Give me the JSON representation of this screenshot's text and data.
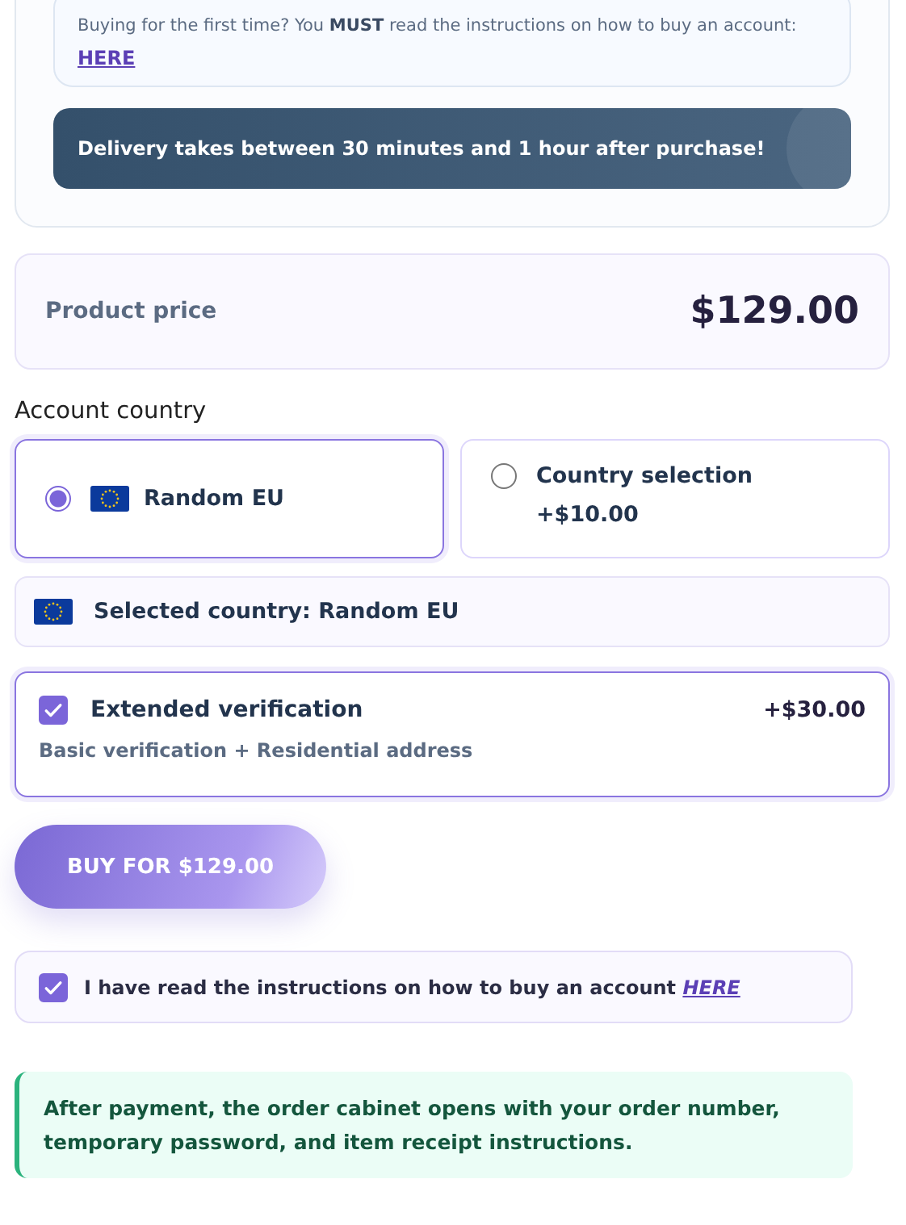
{
  "notice": {
    "text": "Buying for the first time? You **MUST** read the instructions on how to buy an account:",
    "link": "HERE"
  },
  "delivery_banner": "Delivery takes between 30 minutes and 1 hour after purchase!",
  "price": {
    "label": "Product price",
    "value": "$129.00"
  },
  "country_label": "Account country",
  "country_options": [
    {
      "label": "Random EU",
      "flag": true,
      "selected": true
    },
    {
      "label": "Country selection",
      "flag": false,
      "extra": "+$10.00",
      "selected": false
    }
  ],
  "selected_country": "Selected country: Random EU",
  "verification": {
    "title": "Extended verification",
    "price": "+$30.00",
    "description": "Basic verification + Residential address",
    "checked": true
  },
  "buy_button": "BUY FOR $129.00",
  "agreement": {
    "text": "I have read the instructions on how to buy an account",
    "link": "HERE",
    "checked": true
  },
  "info_note": "After payment, the order cabinet opens with your order number, temporary password, and item receipt instructions."
}
